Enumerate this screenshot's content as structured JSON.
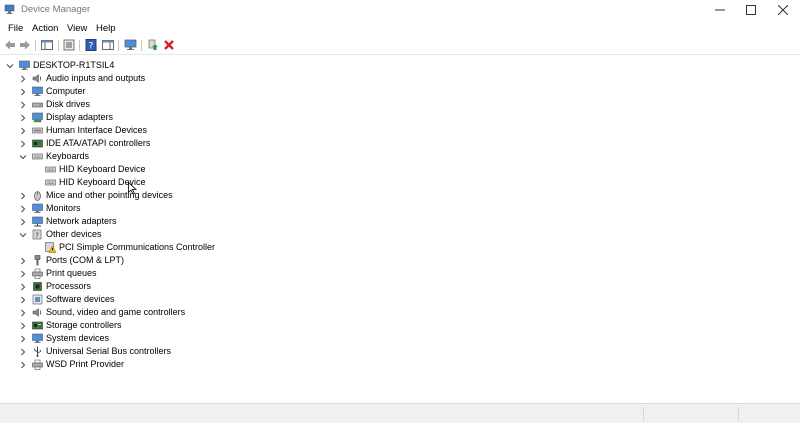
{
  "window": {
    "title": "Device Manager"
  },
  "menu": [
    "File",
    "Action",
    "View",
    "Help"
  ],
  "toolbar": {
    "buttons": [
      {
        "name": "back-button",
        "icon": "arrow-left-icon"
      },
      {
        "name": "forward-button",
        "icon": "arrow-right-icon"
      },
      {
        "name": "show-hide-console-tree-button",
        "icon": "console-tree-icon"
      },
      {
        "name": "properties-button",
        "icon": "properties-icon"
      },
      {
        "name": "help-button",
        "icon": "help-icon"
      },
      {
        "name": "action-pane-button",
        "icon": "action-pane-icon"
      },
      {
        "name": "scan-hardware-changes-button",
        "icon": "monitor-scan-icon"
      },
      {
        "name": "update-driver-button",
        "icon": "update-driver-icon"
      },
      {
        "name": "uninstall-device-button",
        "icon": "red-x-icon"
      }
    ]
  },
  "tree": {
    "root": "DESKTOP-R1TSIL4",
    "items": [
      {
        "label": "Audio inputs and outputs",
        "icon": "speaker-icon",
        "expanded": false
      },
      {
        "label": "Computer",
        "icon": "computer-icon",
        "expanded": false
      },
      {
        "label": "Disk drives",
        "icon": "disk-drive-icon",
        "expanded": false
      },
      {
        "label": "Display adapters",
        "icon": "display-adapter-icon",
        "expanded": false
      },
      {
        "label": "Human Interface Devices",
        "icon": "hid-icon",
        "expanded": false
      },
      {
        "label": "IDE ATA/ATAPI controllers",
        "icon": "ide-controller-icon",
        "expanded": false
      },
      {
        "label": "Keyboards",
        "icon": "keyboard-icon",
        "expanded": true,
        "children": [
          "HID Keyboard Device",
          "HID Keyboard Device"
        ]
      },
      {
        "label": "Mice and other pointing devices",
        "icon": "mouse-icon",
        "expanded": false
      },
      {
        "label": "Monitors",
        "icon": "monitor-icon",
        "expanded": false
      },
      {
        "label": "Network adapters",
        "icon": "network-adapter-icon",
        "expanded": false
      },
      {
        "label": "Other devices",
        "icon": "other-devices-icon",
        "expanded": true,
        "children": [
          "PCI Simple Communications Controller"
        ]
      },
      {
        "label": "Ports (COM & LPT)",
        "icon": "port-icon",
        "expanded": false
      },
      {
        "label": "Print queues",
        "icon": "printer-icon",
        "expanded": false
      },
      {
        "label": "Processors",
        "icon": "processor-icon",
        "expanded": false
      },
      {
        "label": "Software devices",
        "icon": "software-device-icon",
        "expanded": false
      },
      {
        "label": "Sound, video and game controllers",
        "icon": "sound-controller-icon",
        "expanded": false
      },
      {
        "label": "Storage controllers",
        "icon": "storage-controller-icon",
        "expanded": false
      },
      {
        "label": "System devices",
        "icon": "system-devices-icon",
        "expanded": false
      },
      {
        "label": "Universal Serial Bus controllers",
        "icon": "usb-icon",
        "expanded": false
      },
      {
        "label": "WSD Print Provider",
        "icon": "wsd-printer-icon",
        "expanded": false
      }
    ]
  }
}
